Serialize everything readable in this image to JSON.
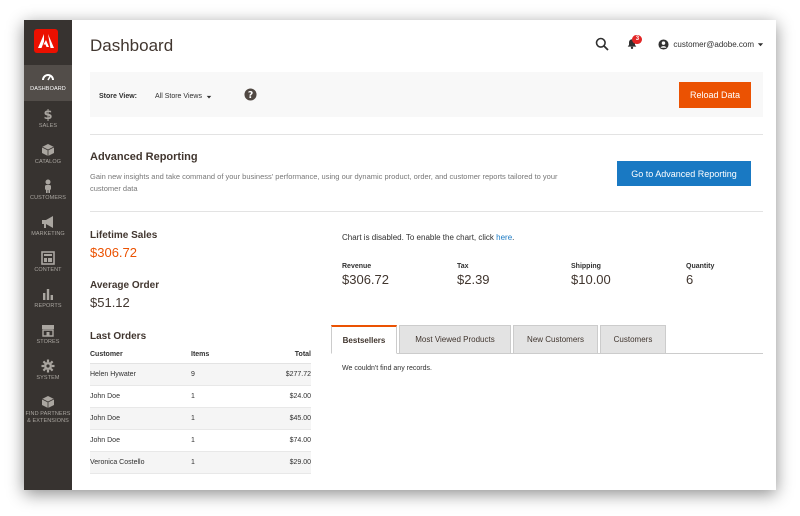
{
  "sidebar": {
    "items": [
      {
        "label": "Dashboard",
        "icon": "dashboard-icon"
      },
      {
        "label": "Sales",
        "icon": "dollar-icon"
      },
      {
        "label": "Catalog",
        "icon": "box-icon"
      },
      {
        "label": "Customers",
        "icon": "person-icon"
      },
      {
        "label": "Marketing",
        "icon": "megaphone-icon"
      },
      {
        "label": "Content",
        "icon": "layout-icon"
      },
      {
        "label": "Reports",
        "icon": "bar-chart-icon"
      },
      {
        "label": "Stores",
        "icon": "store-icon"
      },
      {
        "label": "System",
        "icon": "gear-icon"
      },
      {
        "label": "Find Partners\n& Extensions",
        "icon": "cube-icon"
      }
    ]
  },
  "header": {
    "title": "Dashboard",
    "notification_count": "3",
    "account": "customer@adobe.com"
  },
  "store_bar": {
    "label": "Store View:",
    "selected": "All Store Views",
    "reload_label": "Reload Data"
  },
  "advanced": {
    "title": "Advanced Reporting",
    "description": "Gain new insights and take command of your business' performance, using our dynamic product, order, and customer reports tailored to your customer data",
    "button": "Go to Advanced Reporting"
  },
  "stats": {
    "lifetime_label": "Lifetime Sales",
    "lifetime_value": "$306.72",
    "avg_label": "Average Order",
    "avg_value": "$51.12"
  },
  "orders": {
    "title": "Last Orders",
    "headers": {
      "customer": "Customer",
      "items": "Items",
      "total": "Total"
    },
    "rows": [
      {
        "customer": "Helen Hywater",
        "items": "9",
        "total": "$277.72"
      },
      {
        "customer": "John Doe",
        "items": "1",
        "total": "$24.00"
      },
      {
        "customer": "John Doe",
        "items": "1",
        "total": "$45.00"
      },
      {
        "customer": "John Doe",
        "items": "1",
        "total": "$74.00"
      },
      {
        "customer": "Veronica Costello",
        "items": "1",
        "total": "$29.00"
      }
    ]
  },
  "chart_note": {
    "text": "Chart is disabled. To enable the chart, click ",
    "link": "here",
    "suffix": "."
  },
  "totals": [
    {
      "label": "Revenue",
      "value": "$306.72"
    },
    {
      "label": "Tax",
      "value": "$2.39"
    },
    {
      "label": "Shipping",
      "value": "$10.00"
    },
    {
      "label": "Quantity",
      "value": "6"
    }
  ],
  "tabs": [
    {
      "label": "Bestsellers"
    },
    {
      "label": "Most Viewed Products"
    },
    {
      "label": "New Customers"
    },
    {
      "label": "Customers"
    }
  ],
  "tab_content": "We couldn't find any records.",
  "colors": {
    "accent": "#eb5202",
    "sidebar": "#373330",
    "link": "#1979c3",
    "logo": "#eb1000"
  }
}
